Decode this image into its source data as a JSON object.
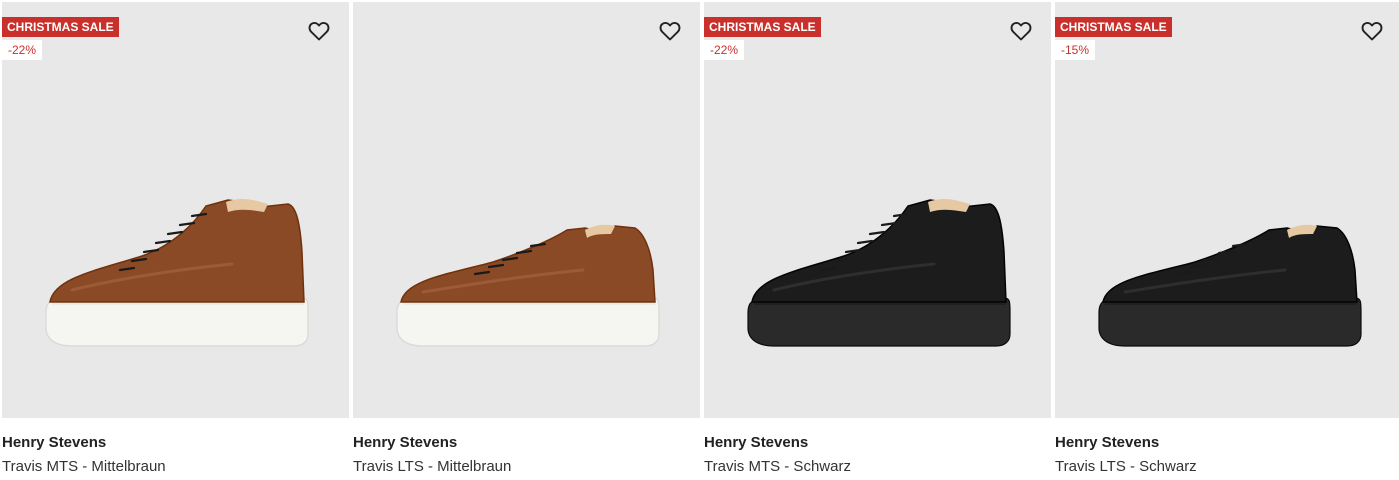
{
  "products": [
    {
      "sale_label": "CHRISTMAS SALE",
      "discount": "-22%",
      "brand": "Henry Stevens",
      "name": "Travis MTS - Mittelbraun",
      "shoe_style": "high-top",
      "shoe_color": "#8a4a25",
      "sole_color": "#f5f5f2"
    },
    {
      "sale_label": "",
      "discount": "",
      "brand": "Henry Stevens",
      "name": "Travis LTS - Mittelbraun",
      "shoe_style": "low-top",
      "shoe_color": "#8a4a25",
      "sole_color": "#f5f5f2"
    },
    {
      "sale_label": "CHRISTMAS SALE",
      "discount": "-22%",
      "brand": "Henry Stevens",
      "name": "Travis MTS - Schwarz",
      "shoe_style": "high-top",
      "shoe_color": "#1c1c1c",
      "sole_color": "#2a2a2a"
    },
    {
      "sale_label": "CHRISTMAS SALE",
      "discount": "-15%",
      "brand": "Henry Stevens",
      "name": "Travis LTS - Schwarz",
      "shoe_style": "low-top",
      "shoe_color": "#1c1c1c",
      "sole_color": "#2a2a2a"
    }
  ],
  "icons": {
    "wishlist": "heart-outline-icon"
  },
  "colors": {
    "sale_badge_bg": "#c9302c",
    "discount_text": "#c9302c",
    "image_bg": "#e8e8e8"
  }
}
